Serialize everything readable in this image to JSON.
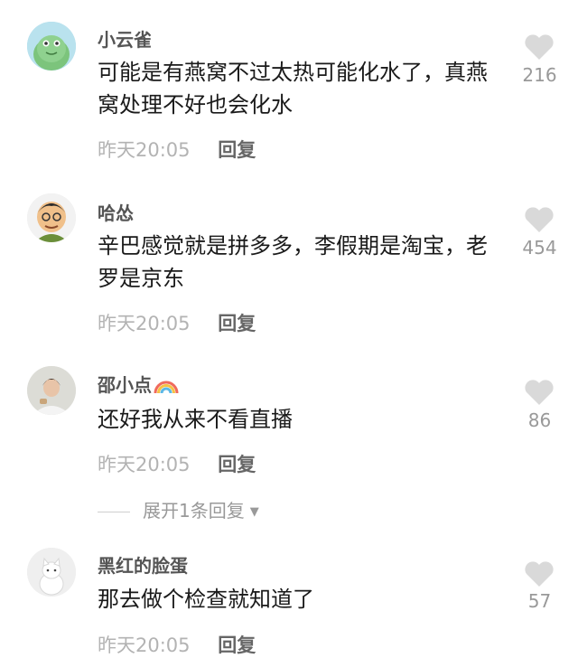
{
  "comments": [
    {
      "username": "小云雀",
      "text": "可能是有燕窝不过太热可能化水了，真燕窝处理不好也会化水",
      "time": "昨天20:05",
      "reply": "回复",
      "likes": "216",
      "avatar_icon": "green-frog-avatar"
    },
    {
      "username": "哈怂",
      "text": "辛巴感觉就是拼多多，李假期是淘宝，老罗是京东",
      "time": "昨天20:05",
      "reply": "回复",
      "likes": "454",
      "avatar_icon": "cartoon-man-avatar"
    },
    {
      "username": "邵小点",
      "text": "还好我从来不看直播",
      "time": "昨天20:05",
      "reply": "回复",
      "likes": "86",
      "avatar_icon": "person-photo-avatar",
      "badge_icon": "rainbow-icon"
    },
    {
      "username": "黑红的脸蛋",
      "text": "那去做个检查就知道了",
      "time": "昨天20:05",
      "reply": "回复",
      "likes": "57",
      "avatar_icon": "white-cat-avatar"
    }
  ],
  "expand_replies": {
    "label": "展开1条回复",
    "icon": "caret-down-icon"
  },
  "colors": {
    "text": "#1a1a1a",
    "username": "#555555",
    "muted": "#b3b3b3",
    "heart": "#d9d9d9"
  }
}
